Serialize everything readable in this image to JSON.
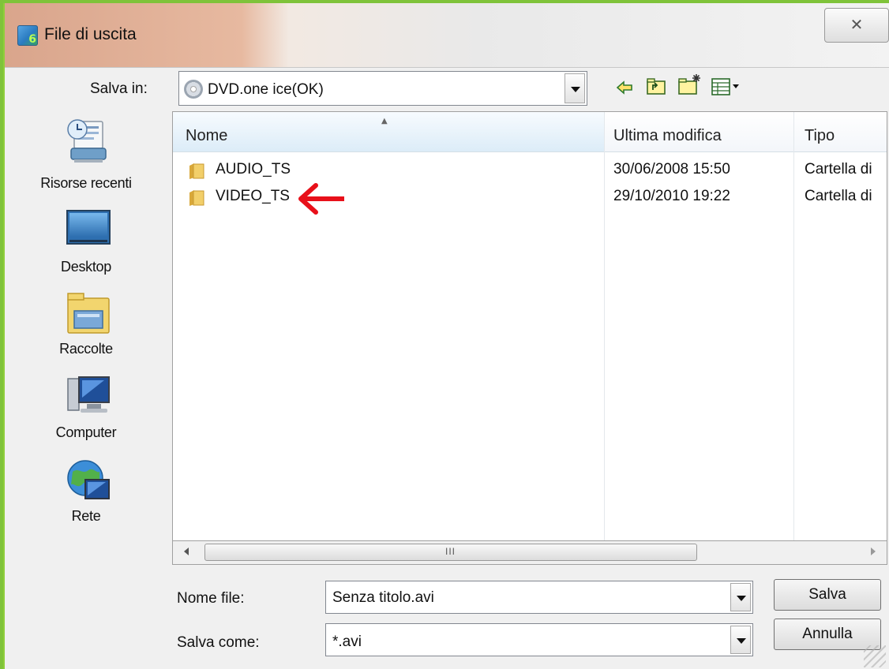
{
  "window": {
    "title": "File di uscita",
    "close_glyph": "✕"
  },
  "toolbar": {
    "save_in_label": "Salva in:",
    "save_in_value": "DVD.one ice(OK)",
    "icons": [
      "back-icon",
      "up-folder-icon",
      "new-folder-icon",
      "view-menu-icon"
    ]
  },
  "places": [
    {
      "label": "Risorse recenti",
      "icon": "recent-places-icon"
    },
    {
      "label": "Desktop",
      "icon": "desktop-icon"
    },
    {
      "label": "Raccolte",
      "icon": "libraries-icon"
    },
    {
      "label": "Computer",
      "icon": "computer-icon"
    },
    {
      "label": "Rete",
      "icon": "network-icon"
    }
  ],
  "file_list": {
    "columns": [
      "Nome",
      "Ultima modifica",
      "Tipo"
    ],
    "rows": [
      {
        "name": "AUDIO_TS",
        "modified": "30/06/2008 15:50",
        "type": "Cartella di"
      },
      {
        "name": "VIDEO_TS",
        "modified": "29/10/2010 19:22",
        "type": "Cartella di"
      }
    ],
    "scroll_grip": "III"
  },
  "form": {
    "file_name_label": "Nome file:",
    "file_name_value": "Senza titolo.avi",
    "save_as_label": "Salva come:",
    "save_as_value": "*.avi",
    "save_button": "Salva",
    "cancel_button": "Annulla"
  },
  "colors": {
    "annotation_arrow": "#e8101a",
    "accent_border": "#8fce3a",
    "folder": "#e8c25a"
  }
}
